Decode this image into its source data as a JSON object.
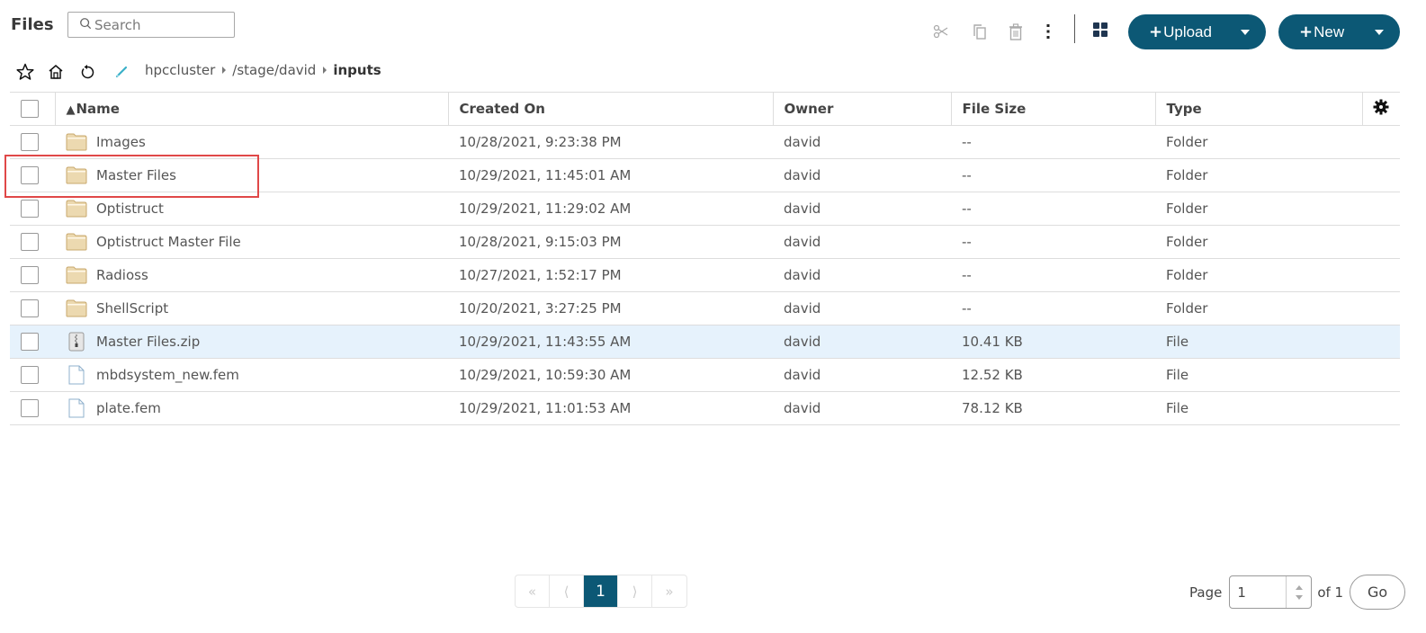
{
  "header": {
    "title": "Files",
    "search_placeholder": "Search"
  },
  "toolbar": {
    "icons": [
      "scissors-icon",
      "copy-icon",
      "trash-icon",
      "more-vertical-icon",
      "grid-view-icon"
    ],
    "upload_label": "Upload",
    "new_label": "New",
    "accent_color": "#0c5875"
  },
  "breadcrumb": {
    "icons": [
      "star-icon",
      "home-icon",
      "refresh-icon",
      "edit-pencil-icon"
    ],
    "items": [
      "hpccluster",
      "/stage/david"
    ],
    "current": "inputs"
  },
  "table": {
    "columns": [
      "Name",
      "Created On",
      "Owner",
      "File Size",
      "Type"
    ],
    "sort_indicator": "▲",
    "rows": [
      {
        "name": "Images",
        "created": "10/28/2021, 9:23:38 PM",
        "owner": "david",
        "size": "--",
        "type": "Folder",
        "icon": "folder-icon"
      },
      {
        "name": "Master Files",
        "created": "10/29/2021, 11:45:01 AM",
        "owner": "david",
        "size": "--",
        "type": "Folder",
        "icon": "folder-icon"
      },
      {
        "name": "Optistruct",
        "created": "10/29/2021, 11:29:02 AM",
        "owner": "david",
        "size": "--",
        "type": "Folder",
        "icon": "folder-icon"
      },
      {
        "name": "Optistruct Master File",
        "created": "10/28/2021, 9:15:03 PM",
        "owner": "david",
        "size": "--",
        "type": "Folder",
        "icon": "folder-icon"
      },
      {
        "name": "Radioss",
        "created": "10/27/2021, 1:52:17 PM",
        "owner": "david",
        "size": "--",
        "type": "Folder",
        "icon": "folder-icon"
      },
      {
        "name": "ShellScript",
        "created": "10/20/2021, 3:27:25 PM",
        "owner": "david",
        "size": "--",
        "type": "Folder",
        "icon": "folder-icon"
      },
      {
        "name": "Master Files.zip",
        "created": "10/29/2021, 11:43:55 AM",
        "owner": "david",
        "size": "10.41 KB",
        "type": "File",
        "icon": "zip-file-icon"
      },
      {
        "name": "mbdsystem_new.fem",
        "created": "10/29/2021, 10:59:30 AM",
        "owner": "david",
        "size": "12.52 KB",
        "type": "File",
        "icon": "file-icon"
      },
      {
        "name": "plate.fem",
        "created": "10/29/2021, 11:01:53 AM",
        "owner": "david",
        "size": "78.12 KB",
        "type": "File",
        "icon": "file-icon"
      }
    ]
  },
  "pagination": {
    "first": "«",
    "prev": "⟨",
    "current": "1",
    "next": "⟩",
    "last": "»",
    "page_label": "Page",
    "page_value": "1",
    "of_label": "of 1",
    "go_label": "Go"
  }
}
